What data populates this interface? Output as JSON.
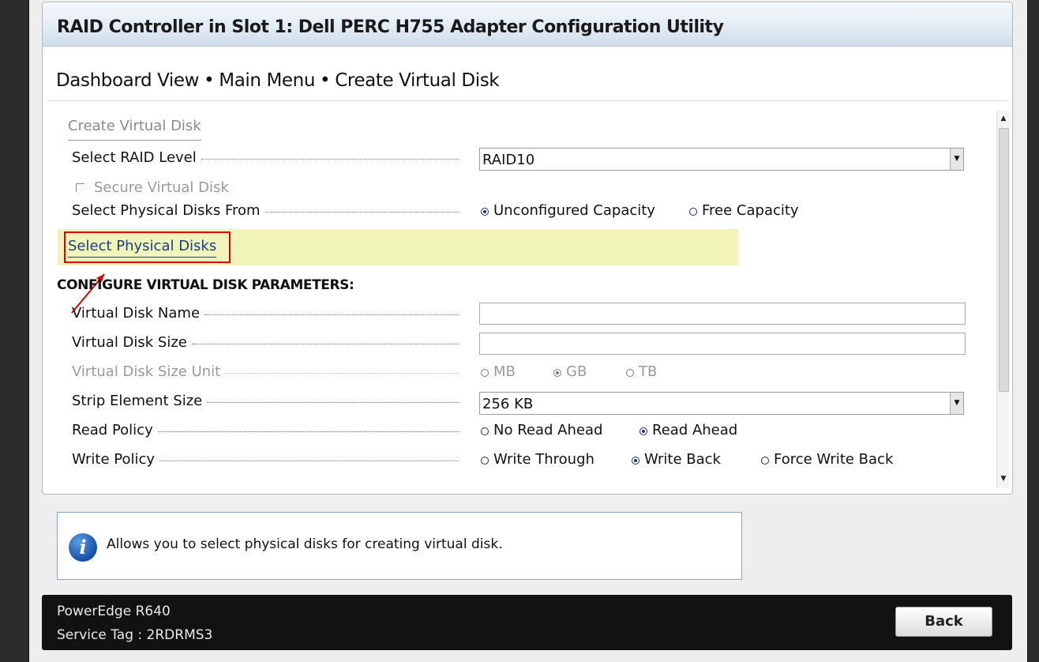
{
  "window": {
    "title": "RAID Controller in Slot 1: Dell PERC H755 Adapter Configuration Utility"
  },
  "breadcrumb": {
    "items": [
      "Dashboard View",
      "Main Menu",
      "Create Virtual Disk"
    ],
    "separator": "•"
  },
  "section": {
    "title": "Create Virtual Disk"
  },
  "form": {
    "raid_level": {
      "label": "Select RAID Level",
      "value": "RAID10"
    },
    "secure": {
      "label": "Secure Virtual Disk",
      "checked": false,
      "enabled": false
    },
    "physical_from": {
      "label": "Select Physical Disks From",
      "options": [
        "Unconfigured Capacity",
        "Free Capacity"
      ],
      "selected": "Unconfigured Capacity"
    },
    "select_disks_link": "Select Physical Disks",
    "params_heading": "CONFIGURE VIRTUAL DISK PARAMETERS:",
    "vd_name": {
      "label": "Virtual Disk Name",
      "value": ""
    },
    "vd_size": {
      "label": "Virtual Disk Size",
      "value": ""
    },
    "vd_size_unit": {
      "label": "Virtual Disk Size Unit",
      "options": [
        "MB",
        "GB",
        "TB"
      ],
      "selected": "GB",
      "enabled": false
    },
    "strip_size": {
      "label": "Strip Element Size",
      "value": "256 KB"
    },
    "read_policy": {
      "label": "Read Policy",
      "options": [
        "No Read Ahead",
        "Read Ahead"
      ],
      "selected": "Read Ahead"
    },
    "write_policy": {
      "label": "Write Policy",
      "options": [
        "Write Through",
        "Write Back",
        "Force Write Back"
      ],
      "selected": "Write Back"
    }
  },
  "help": {
    "text": "Allows you to select physical disks for creating virtual disk.",
    "icon": "info-icon"
  },
  "footer": {
    "model": "PowerEdge R640",
    "service_tag": "Service Tag : 2RDRMS3",
    "back_label": "Back"
  },
  "annotation": {
    "color": "#e00000"
  },
  "colors": {
    "highlight": "#f1f4b9",
    "link": "#1e3c8a",
    "footer_bg": "#121212"
  }
}
